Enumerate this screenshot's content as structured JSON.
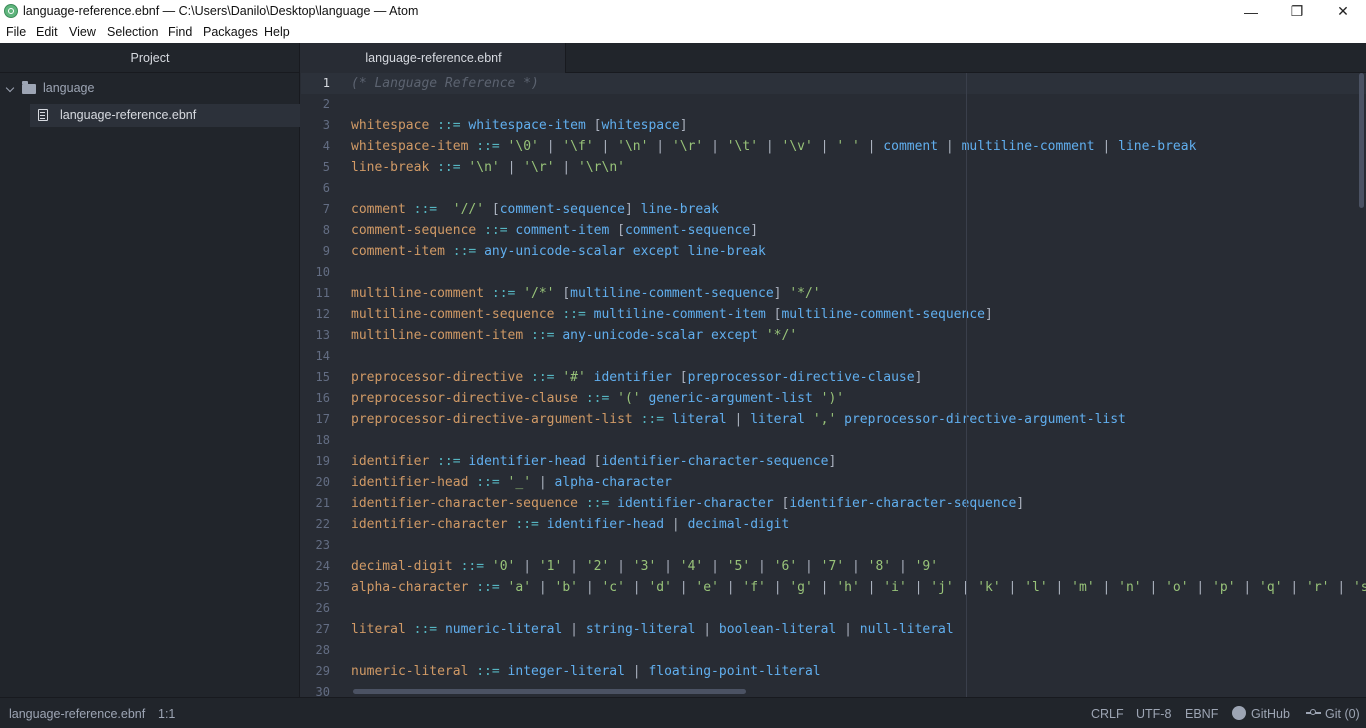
{
  "window": {
    "title": "language-reference.ebnf — C:\\Users\\Danilo\\Desktop\\language — Atom",
    "minimize_glyph": "—",
    "maximize_glyph": "❐",
    "close_glyph": "✕"
  },
  "menu": [
    "File",
    "Edit",
    "View",
    "Selection",
    "Find",
    "Packages",
    "Help"
  ],
  "sidebar": {
    "header": "Project",
    "root_folder": "language",
    "file": "language-reference.ebnf"
  },
  "tab": {
    "label": "language-reference.ebnf"
  },
  "editor": {
    "cursor_line": 1,
    "lines": [
      "(* Language Reference *)",
      "",
      "whitespace ::= whitespace-item [whitespace]",
      "whitespace-item ::= '\\0' | '\\f' | '\\n' | '\\r' | '\\t' | '\\v' | ' ' | comment | multiline-comment | line-break",
      "line-break ::= '\\n' | '\\r' | '\\r\\n'",
      "",
      "comment ::=  '//' [comment-sequence] line-break",
      "comment-sequence ::= comment-item [comment-sequence]",
      "comment-item ::= any-unicode-scalar except line-break",
      "",
      "multiline-comment ::= '/*' [multiline-comment-sequence] '*/'",
      "multiline-comment-sequence ::= multiline-comment-item [multiline-comment-sequence]",
      "multiline-comment-item ::= any-unicode-scalar except '*/'",
      "",
      "preprocessor-directive ::= '#' identifier [preprocessor-directive-clause]",
      "preprocessor-directive-clause ::= '(' generic-argument-list ')'",
      "preprocessor-directive-argument-list ::= literal | literal ',' preprocessor-directive-argument-list",
      "",
      "identifier ::= identifier-head [identifier-character-sequence]",
      "identifier-head ::= '_' | alpha-character",
      "identifier-character-sequence ::= identifier-character [identifier-character-sequence]",
      "identifier-character ::= identifier-head | decimal-digit",
      "",
      "decimal-digit ::= '0' | '1' | '2' | '3' | '4' | '5' | '6' | '7' | '8' | '9'",
      "alpha-character ::= 'a' | 'b' | 'c' | 'd' | 'e' | 'f' | 'g' | 'h' | 'i' | 'j' | 'k' | 'l' | 'm' | 'n' | 'o' | 'p' | 'q' | 'r' | 's'",
      "",
      "literal ::= numeric-literal | string-literal | boolean-literal | null-literal",
      "",
      "numeric-literal ::= integer-literal | floating-point-literal",
      ""
    ]
  },
  "status": {
    "file": "language-reference.ebnf",
    "cursor": "1:1",
    "line_ending": "CRLF",
    "encoding": "UTF-8",
    "grammar": "EBNF",
    "github": "GitHub",
    "git": "Git (0)"
  },
  "colors": {
    "background": "#282c34",
    "panel": "#21252b",
    "rule_name": "#d19a66",
    "reference": "#61afef",
    "string": "#98c379",
    "operator": "#56b6c2",
    "comment": "#5c6370"
  }
}
